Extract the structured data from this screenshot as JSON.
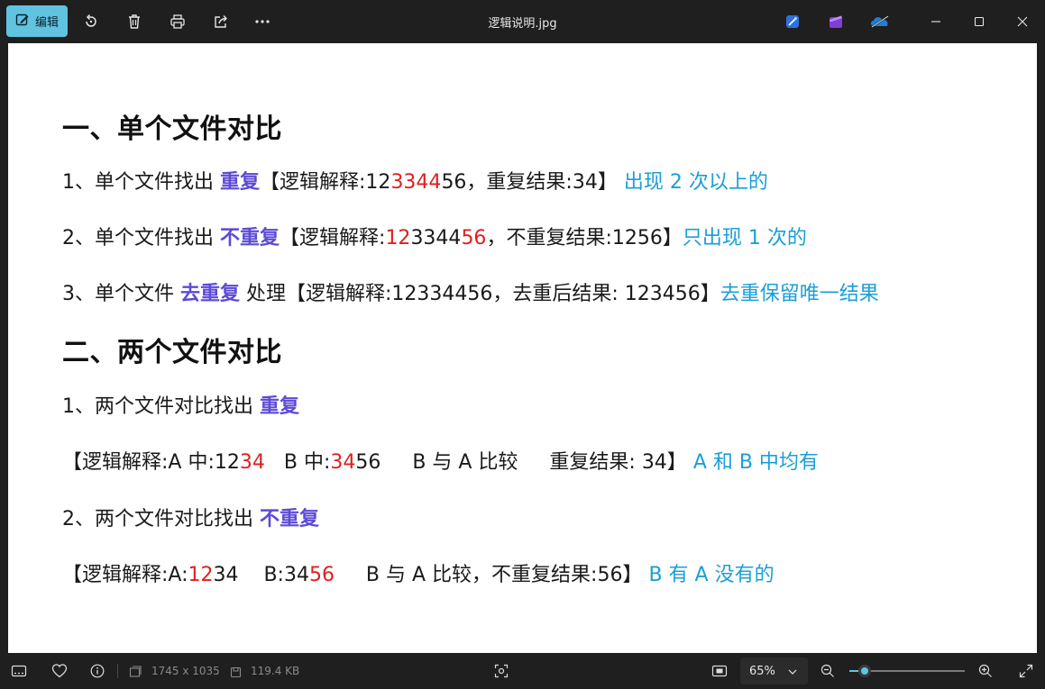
{
  "titlebar": {
    "edit_label": "编辑",
    "file_name": "逻辑说明.jpg"
  },
  "document": {
    "section1_title": "一、单个文件对比",
    "s1_l1": {
      "pre": "1、单个文件找出 ",
      "kw": "重复",
      "a": "【逻辑解释:12",
      "r1": "3344",
      "b": "56，重复结果:34】 ",
      "note": "出现 2 次以上的"
    },
    "s1_l2": {
      "pre": "2、单个文件找出 ",
      "kw": "不重复",
      "a": "【逻辑解释:",
      "r1": "12",
      "b": "3344",
      "r2": "56",
      "c": "，不重复结果:1256】",
      "note": "只出现 1 次的"
    },
    "s1_l3": {
      "pre": "3、单个文件 ",
      "kw": "去重复",
      "a": " 处理【逻辑解释:12334456，去重后结果: 123456】",
      "note": "去重保留唯一结果"
    },
    "section2_title": "二、两个文件对比",
    "s2_l1": {
      "pre": "1、两个文件对比找出 ",
      "kw": "重复"
    },
    "s2_l2": {
      "a": "【逻辑解释:A 中:12",
      "r1": "34",
      "b": "   B 中:",
      "r2": "34",
      "c": "56     B 与 A 比较     重复结果: 34】 ",
      "note": "A 和 B 中均有"
    },
    "s2_l3": {
      "pre": "2、两个文件对比找出 ",
      "kw": "不重复"
    },
    "s2_l4": {
      "a": "【逻辑解释:A:",
      "r1": "12",
      "b": "34    B:34",
      "r2": "56",
      "c": "     B 与 A 比较，不重复结果:56】 ",
      "note": "B 有 A 没有的"
    }
  },
  "statusbar": {
    "dimensions": "1745 x 1035",
    "file_size": "119.4 KB",
    "zoom": "65%",
    "zoom_fraction": 0.13
  },
  "colors": {
    "accent": "#60c3e0",
    "keyword": "#5b4bd6",
    "highlight": "#e0201f",
    "note": "#1a9fd8"
  },
  "icons": [
    "edit-icon",
    "rotate-icon",
    "delete-icon",
    "print-icon",
    "share-icon",
    "more-icon",
    "designer-icon",
    "clipchamp-icon",
    "onedrive-icon",
    "minimize-icon",
    "maximize-icon",
    "close-icon",
    "filmstrip-icon",
    "favorite-icon",
    "info-icon",
    "dimensions-icon",
    "filesize-icon",
    "visual-search-icon",
    "fit-icon",
    "zoom-out-icon",
    "zoom-in-icon",
    "fullscreen-icon"
  ]
}
